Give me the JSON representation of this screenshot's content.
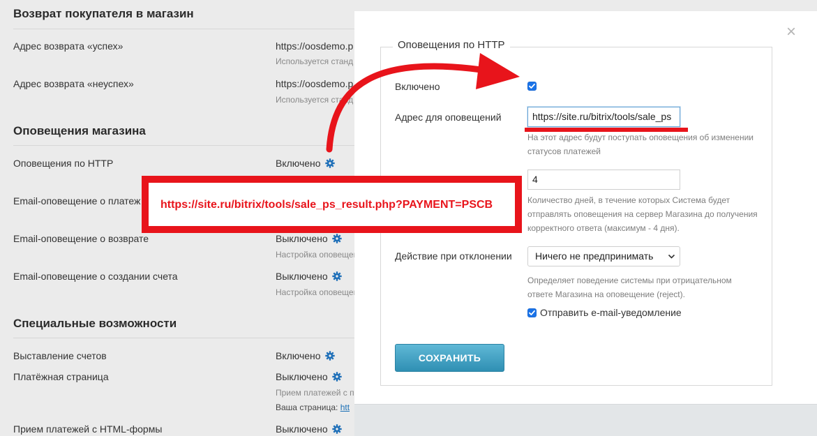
{
  "background": {
    "return_section": {
      "title": "Возврат покупателя в магазин",
      "success_label": "Адрес возврата «успех»",
      "success_value": "https://oosdemo.p",
      "success_hint": "Используется станд",
      "fail_label": "Адрес возврата «неуспех»",
      "fail_value": "https://oosdemo.p",
      "fail_hint": "Используется станд"
    },
    "notify_section": {
      "title": "Оповещения магазина",
      "http_label": "Оповещения по HTTP",
      "http_value": "Включено",
      "email_payment_label": "Email-оповещение о платеж",
      "email_refund_label": "Email-оповещение о возврате",
      "email_refund_value": "Выключено",
      "email_refund_hint": "Настройка оповещения",
      "email_invoice_label": "Email-оповещение о создании счета",
      "email_invoice_value": "Выключено",
      "email_invoice_hint": "Настройка оповещения"
    },
    "special_section": {
      "title": "Специальные возможности",
      "invoicing_label": "Выставление счетов",
      "invoicing_value": "Включено",
      "payment_page_label": "Платёжная страница",
      "payment_page_value": "Выключено",
      "payment_page_hint": "Прием платежей с п",
      "your_page_label": "Ваша страница:",
      "your_page_link": "htt",
      "html_form_label": "Прием платежей с HTML-формы",
      "html_form_value": "Выключено"
    }
  },
  "modal": {
    "close_glyph": "×",
    "legend": "Оповещения по HTTP",
    "enabled_label": "Включено",
    "enabled_checked": true,
    "url_label": "Адрес для оповещений",
    "url_value": "https://site.ru/bitrix/tools/sale_ps",
    "url_hint": "На этот адрес будут поступать оповещения об изменении статусов платежей",
    "days_value": "4",
    "days_hint": "Количество дней, в течение которых Система будет отправлять оповещения на сервер Магазина до получения корректного ответа (максимум - 4 дня).",
    "reject_label": "Действие при отклонении",
    "reject_selected": "Ничего не предпринимать",
    "reject_hint": "Определяет поведение системы при отрицательном ответе Магазина на оповещение (reject).",
    "email_notify_label": "Отправить e-mail-уведомление",
    "email_notify_checked": true,
    "save_label": "СОХРАНИТЬ"
  },
  "annotation": {
    "url_text": "https://site.ru/bitrix/tools/sale_ps_result.php?PAYMENT=PSCB",
    "color": "#e8141b"
  },
  "colors": {
    "accent": "#1a73e8",
    "gear": "#1e6fb8",
    "save_button": "#3a9cc0",
    "annotation_red": "#e8141b"
  },
  "icons": {
    "settings": "gear-icon",
    "close": "close-icon",
    "select_arrow": "chevron-down-icon",
    "checkbox": "checkmark-icon"
  }
}
